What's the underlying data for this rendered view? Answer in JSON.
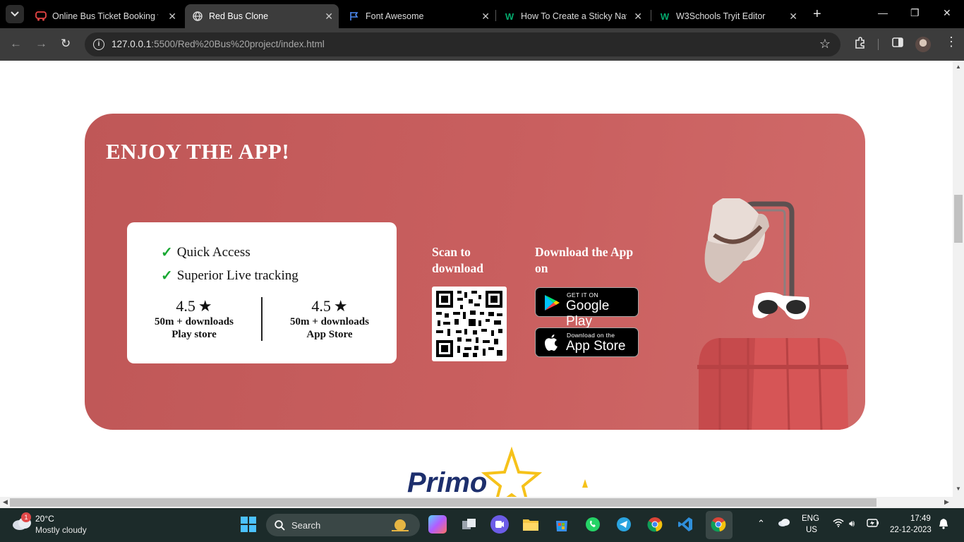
{
  "browser": {
    "tabs": [
      {
        "label": "Online Bus Ticket Booking w",
        "active": false
      },
      {
        "label": "Red Bus Clone",
        "active": true
      },
      {
        "label": "Font Awesome",
        "active": false
      },
      {
        "label": "How To Create a Sticky Navb",
        "active": false
      },
      {
        "label": "W3Schools Tryit Editor",
        "active": false
      }
    ],
    "url_host": "127.0.0.1",
    "url_path": ":5500/Red%20Bus%20project/index.html"
  },
  "page": {
    "banner": {
      "title": "ENJOY THE APP!",
      "features": [
        "Quick Access",
        "Superior Live tracking"
      ],
      "ratings": [
        {
          "score": "4.5",
          "line1": "50m + downloads",
          "line2": "Play store"
        },
        {
          "score": "4.5",
          "line1": "50m + downloads",
          "line2": "App Store"
        }
      ],
      "scan_label": "Scan to download",
      "download_label": "Download the App on",
      "google_play": {
        "small": "GET IT ON",
        "big": "Google Play"
      },
      "app_store": {
        "small": "Download on the",
        "big": "App Store"
      }
    },
    "partner_logo": "Primo"
  },
  "taskbar": {
    "weather_temp": "20°C",
    "weather_cond": "Mostly cloudy",
    "weather_badge": "1",
    "search_label": "Search",
    "lang_top": "ENG",
    "lang_bottom": "US",
    "time": "17:49",
    "date": "22-12-2023"
  },
  "colors": {
    "banner": "#c45a5a",
    "check": "#18a832",
    "taskbar": "#1c2b2a"
  }
}
